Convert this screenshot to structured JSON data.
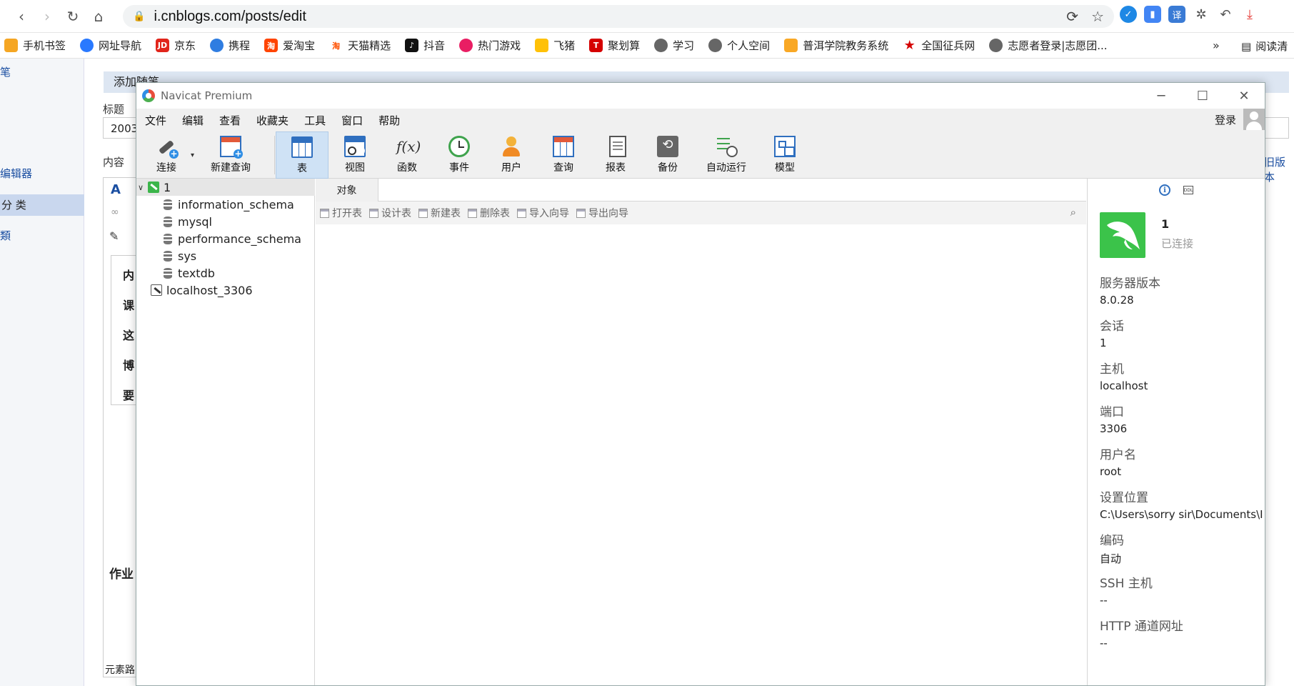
{
  "browser": {
    "url": "i.cnblogs.com/posts/edit",
    "bookmarks": [
      "手机书签",
      "网址导航",
      "京东",
      "携程",
      "爱淘宝",
      "天猫精选",
      "抖音",
      "热门游戏",
      "飞猪",
      "聚划算",
      "学习",
      "个人空间",
      "普洱学院教务系统",
      "全国征兵网",
      "志愿者登录|志愿团..."
    ],
    "bookmark_more": "»",
    "reading_mode": "阅读清",
    "ext_translate": "译"
  },
  "blog": {
    "header": "添加随笔",
    "title_label": "标题",
    "title_value": "2003",
    "content_label": "内容",
    "sidebar": [
      "笔",
      "",
      "",
      "编辑器",
      "分    类",
      "類"
    ],
    "right_link": "旧版本",
    "content_rows": [
      "内",
      "课",
      "这",
      "博",
      "要"
    ],
    "assignment": "作业",
    "element_path": "元素路"
  },
  "navicat": {
    "title": "Navicat Premium",
    "menu": [
      "文件",
      "编辑",
      "查看",
      "收藏夹",
      "工具",
      "窗口",
      "帮助"
    ],
    "login": "登录",
    "toolbar": {
      "connect": "连接",
      "new_query": "新建查询",
      "table": "表",
      "view": "视图",
      "function": "函数",
      "event": "事件",
      "user": "用户",
      "query": "查询",
      "report": "报表",
      "backup": "备份",
      "autorun": "自动运行",
      "model": "模型"
    },
    "tree": {
      "connection": "1",
      "databases": [
        "information_schema",
        "mysql",
        "performance_schema",
        "sys",
        "textdb"
      ],
      "other_connection": "localhost_3306"
    },
    "objects_tab": "对象",
    "object_tools": [
      "打开表",
      "设计表",
      "新建表",
      "删除表",
      "导入向导",
      "导出向导"
    ],
    "info": {
      "name": "1",
      "status": "已连接",
      "props": [
        {
          "k": "服务器版本",
          "v": "8.0.28"
        },
        {
          "k": "会话",
          "v": "1"
        },
        {
          "k": "主机",
          "v": "localhost"
        },
        {
          "k": "端口",
          "v": "3306"
        },
        {
          "k": "用户名",
          "v": "root"
        },
        {
          "k": "设置位置",
          "v": "C:\\Users\\sorry sir\\Documents\\I"
        },
        {
          "k": "编码",
          "v": "自动"
        },
        {
          "k": "SSH 主机",
          "v": "--"
        },
        {
          "k": "HTTP 通道网址",
          "v": "--"
        }
      ]
    }
  }
}
